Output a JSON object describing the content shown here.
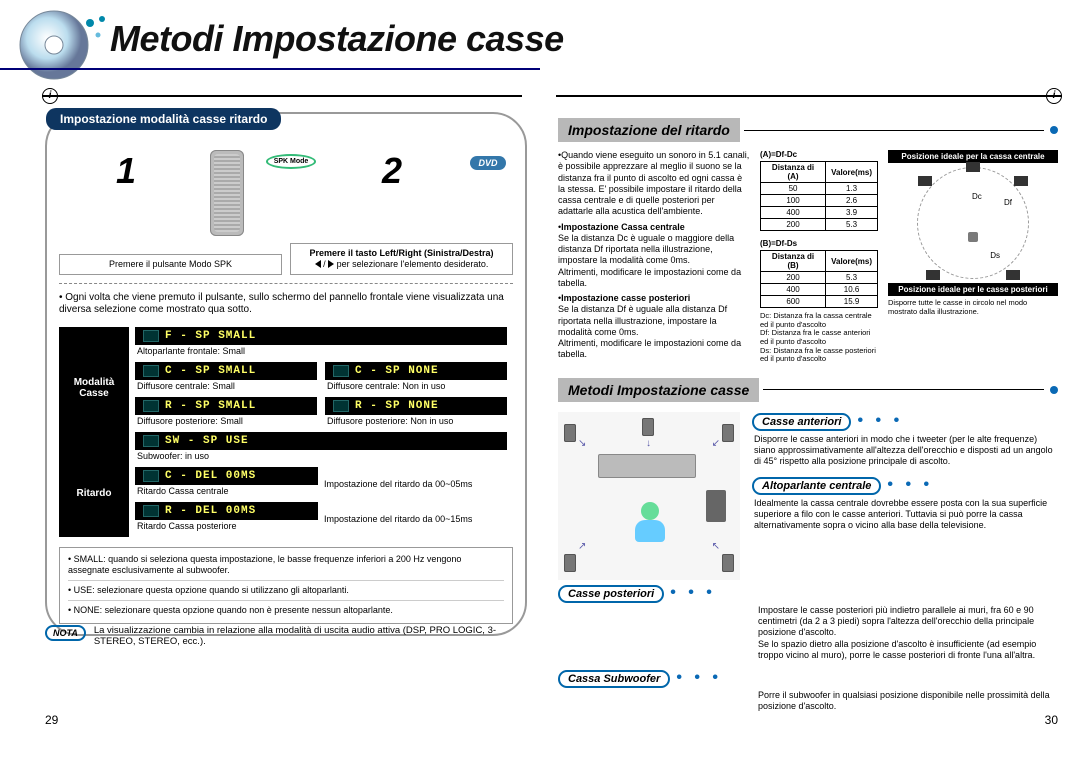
{
  "page_title": "Metodi Impostazione casse",
  "left": {
    "module_header": "Impostazione modalità casse ritardo",
    "spk_badge": "SPK Mode",
    "dvd_badge": "DVD",
    "step1_num": "1",
    "step2_num": "2",
    "step1_text": "Premere il pulsante Modo SPK",
    "step2_line1": "Premere il tasto Left/Right (Sinistra/Destra)",
    "step2_line2": "( ◀ / ▶ ) per selezionare l'elemento desiderato.",
    "lead": "Ogni volta che viene premuto il pulsante, sullo schermo del pannello frontale viene visualizzata una diversa selezione come mostrato qua sotto.",
    "sidebar_mode": "Modalità Casse",
    "sidebar_delay": "Ritardo",
    "displays": [
      {
        "code": "F - SP  SMALL",
        "caption": "Altoparlante frontale: Small"
      },
      {
        "code": "C - SP  SMALL",
        "caption": "Diffusore centrale: Small"
      },
      {
        "code": "R - SP  SMALL",
        "caption": "Diffusore posteriore: Small"
      },
      {
        "code": "SW - SP USE",
        "caption": "Subwoofer: in uso"
      }
    ],
    "displays_right": [
      {
        "code": "C - SP  NONE",
        "caption": "Diffusore centrale: Non in uso"
      },
      {
        "code": "R - SP  NONE",
        "caption": "Diffusore posteriore: Non in uso"
      }
    ],
    "delay_rows": [
      {
        "code": "C - DEL  00MS",
        "caption": "Ritardo Cassa centrale",
        "side": "Impostazione del ritardo da 00~05ms"
      },
      {
        "code": "R - DEL  00MS",
        "caption": "Ritardo Cassa posteriore",
        "side": "Impostazione del ritardo da 00~15ms"
      }
    ],
    "notes": [
      "SMALL: quando si seleziona questa impostazione, le basse frequenze inferiori a 200 Hz vengono assegnate esclusivamente al subwoofer.",
      "USE: selezionare questa opzione quando si utilizzano gli altoparlanti.",
      "NONE: selezionare questa opzione quando non è presente nessun altoparlante."
    ],
    "nota_label": "NOTA",
    "nota_text": "La visualizzazione cambia in relazione alla modalità di uscita audio attiva (DSP, PRO LOGIC, 3-STEREO, STEREO, ecc.).",
    "pagenum": "29"
  },
  "right": {
    "section1_title": "Impostazione del ritardo",
    "s1_intro": "Quando viene eseguito un sonoro in 5.1 canali, è possibile apprezzare al meglio il suono se la distanza fra il punto di ascolto ed ogni cassa è la stessa. E' possibile impostare il ritardo della cassa centrale e di quelle posteriori per adattarle alla acustica dell'ambiente.",
    "s1_center_head": "Impostazione Cassa centrale",
    "s1_center_body": "Se la distanza Dc è uguale o maggiore della distanza Df riportata nella illustrazione, impostare la modalità come 0ms.\nAltrimenti, modificare le impostazioni come da tabella.",
    "s1_rear_head": "Impostazione casse posteriori",
    "s1_rear_body": "Se la distanza Df è uguale alla distanza Df riportata nella illustrazione, impostare la modalità come 0ms.\nAltrimenti, modificare le impostazioni come da tabella.",
    "tableA": {
      "caption": "(A)=Df-Dc",
      "head": [
        "Distanza di (A)",
        "Valore(ms)"
      ],
      "rows": [
        [
          "50",
          "1.3"
        ],
        [
          "100",
          "2.6"
        ],
        [
          "400",
          "3.9"
        ],
        [
          "200",
          "5.3"
        ]
      ]
    },
    "tableB": {
      "caption": "(B)=Df-Ds",
      "head": [
        "Distanza di (B)",
        "Valore(ms)"
      ],
      "rows": [
        [
          "200",
          "5.3"
        ],
        [
          "400",
          "10.6"
        ],
        [
          "600",
          "15.9"
        ]
      ]
    },
    "legend": "Dc: Distanza fra la cassa centrale ed il punto d'ascolto\nDf: Distanza fra le casse anteriori ed il punto d'ascolto\nDs: Distanza fra le casse posteriori ed il punto d'ascolto",
    "diag_top_label": "Posizione ideale per la cassa centrale",
    "diag_bot_label": "Posizione ideale per le casse posteriori",
    "diag_dc": "Dc",
    "diag_df": "Df",
    "diag_ds": "Ds",
    "diag_caption": "Disporre tutte le casse in circolo nel modo mostrato dalla illustrazione.",
    "section2_title": "Metodi Impostazione casse",
    "front_label": "Casse anteriori",
    "front_text": "Disporre le casse anteriori in modo che i tweeter (per le alte frequenze) siano approssimativamente all'altezza dell'orecchio e disposti ad un angolo di 45° rispetto alla posizione principale di ascolto.",
    "center_label": "Altoparlante centrale",
    "center_text": "Idealmente la cassa centrale dovrebbe essere posta con la sua superficie superiore a filo con le casse anteriori. Tuttavia si può porre la cassa alternativamente sopra o vicino alla base della televisione.",
    "rear_label": "Casse posteriori",
    "rear_text": "Impostare le casse posteriori più indietro parallele ai muri, fra 60 e 90 centimetri (da 2 a 3 piedi) sopra l'altezza dell'orecchio della principale posizione d'ascolto.\nSe lo spazio dietro alla posizione d'ascolto è insufficiente (ad esempio troppo vicino al muro), porre le casse posteriori di fronte l'una all'altra.",
    "sub_label": "Cassa Subwoofer",
    "sub_text": "Porre il subwoofer in qualsiasi posizione disponibile nelle prossimità della posizione d'ascolto.",
    "pagenum": "30"
  },
  "icons": {
    "info": "i"
  }
}
